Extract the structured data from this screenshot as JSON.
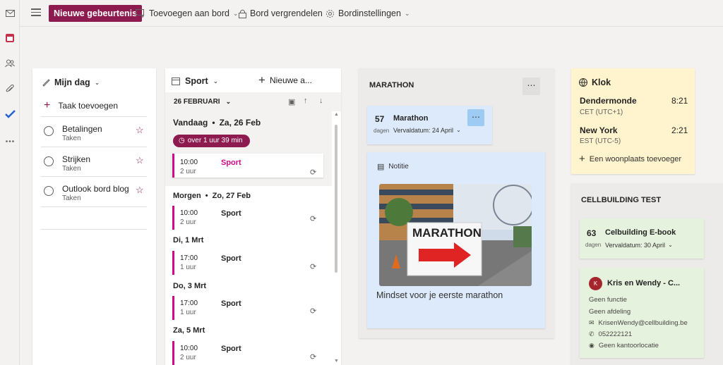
{
  "topbar": {
    "new_event": "Nieuwe gebeurtenis",
    "add_to_board": "Toevoegen aan bord",
    "lock_board": "Bord vergrendelen",
    "board_settings": "Bordinstellingen"
  },
  "myday": {
    "title": "Mijn dag",
    "add_task": "Taak toevoegen",
    "tasks": [
      {
        "name": "Betalingen",
        "sub": "Taken"
      },
      {
        "name": "Strijken",
        "sub": "Taken"
      },
      {
        "name": "Outlook bord blog",
        "sub": "Taken"
      }
    ]
  },
  "calendar": {
    "title": "Sport",
    "new_event": "Nieuwe a...",
    "date_header": "26 FEBRUARI",
    "today_label": "Vandaag",
    "today_date": "Za, 26 Feb",
    "countdown": "over 1 uur 39 min",
    "groups": [
      {
        "day": "Morgen",
        "date": "Zo, 27 Feb",
        "time": "10:00",
        "dur": "2 uur",
        "name": "Sport"
      },
      {
        "day": "Di, 1 Mrt",
        "date": "",
        "time": "17:00",
        "dur": "1 uur",
        "name": "Sport"
      },
      {
        "day": "Do, 3 Mrt",
        "date": "",
        "time": "17:00",
        "dur": "1 uur",
        "name": "Sport"
      },
      {
        "day": "Za, 5 Mrt",
        "date": "",
        "time": "10:00",
        "dur": "2 uur",
        "name": "Sport"
      }
    ],
    "today_event": {
      "time": "10:00",
      "dur": "2 uur",
      "name": "Sport"
    }
  },
  "marathon": {
    "title": "MARATHON",
    "countdown_num": "57",
    "countdown_unit": "dagen",
    "countdown_name": "Marathon",
    "due": "Vervaldatum: 24 April",
    "note_label": "Notitie",
    "sign_text": "MARATHON",
    "note_caption": "Mindset voor je eerste marathon"
  },
  "clock": {
    "title": "Klok",
    "cities": [
      {
        "name": "Dendermonde",
        "time": "8:21",
        "tz": "CET (UTC+1)"
      },
      {
        "name": "New York",
        "time": "2:21",
        "tz": "EST (UTC-5)"
      }
    ],
    "add_place": "Een woonplaats toevoeger"
  },
  "cellbuilding": {
    "title": "CELLBUILDING TEST",
    "countdown_num": "63",
    "countdown_unit": "dagen",
    "countdown_name": "Celbuilding E-book",
    "due": "Vervaldatum: 30 April",
    "contact_initial": "K",
    "contact_name": "Kris en Wendy - C...",
    "function": "Geen functie",
    "department": "Geen afdeling",
    "email": "KrisenWendy@cellbuilding.be",
    "phone": "052222121",
    "office": "Geen kantoorlocatie"
  },
  "colors": {
    "accent": "#8e1b4f",
    "event_bar": "#d10a8a",
    "clock_bg": "#fff4ce",
    "task_bg": "#e5f2dd",
    "marathon_blue": "#ddeafb"
  }
}
